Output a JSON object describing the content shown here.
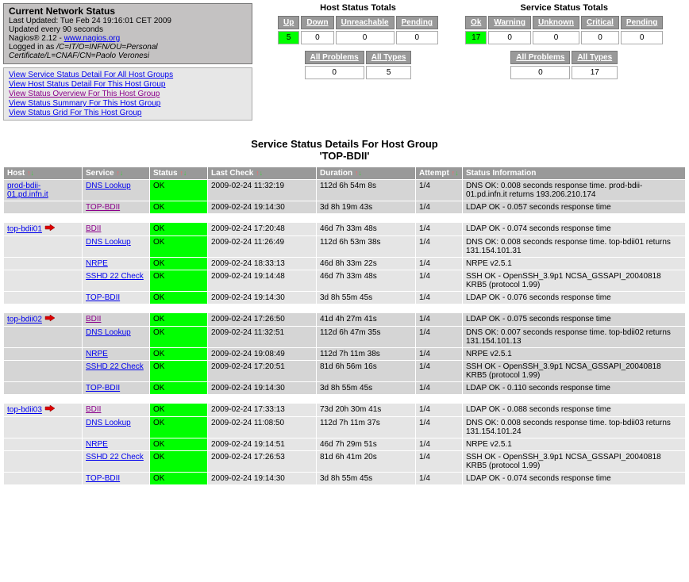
{
  "info": {
    "title": "Current Network Status",
    "last_updated": "Last Updated: Tue Feb 24 19:16:01 CET 2009",
    "updated_every": "Updated every 90 seconds",
    "nagios_prefix": "Nagios® 2.12 - ",
    "nagios_link": "www.nagios.org",
    "logged_in_prefix": "Logged in as ",
    "logged_in_user": "/C=IT/O=INFN/OU=Personal Certificate/L=CNAF/CN=Paolo Veronesi"
  },
  "links": [
    {
      "text": "View Service Status Detail For All Host Groups",
      "visited": false
    },
    {
      "text": "View Host Status Detail For This Host Group",
      "visited": false
    },
    {
      "text": "View Status Overview For This Host Group",
      "visited": true
    },
    {
      "text": "View Status Summary For This Host Group",
      "visited": false
    },
    {
      "text": "View Status Grid For This Host Group",
      "visited": false
    }
  ],
  "host_totals": {
    "title": "Host Status Totals",
    "headers": [
      "Up",
      "Down",
      "Unreachable",
      "Pending"
    ],
    "values": [
      "5",
      "0",
      "0",
      "0"
    ],
    "ok_index": 0,
    "summary_headers": [
      "All Problems",
      "All Types"
    ],
    "summary_values": [
      "0",
      "5"
    ]
  },
  "service_totals": {
    "title": "Service Status Totals",
    "headers": [
      "Ok",
      "Warning",
      "Unknown",
      "Critical",
      "Pending"
    ],
    "values": [
      "17",
      "0",
      "0",
      "0",
      "0"
    ],
    "ok_index": 0,
    "summary_headers": [
      "All Problems",
      "All Types"
    ],
    "summary_values": [
      "0",
      "17"
    ]
  },
  "page_title_1": "Service Status Details For Host Group",
  "page_title_2": "'TOP-BDII'",
  "columns": [
    "Host",
    "Service",
    "Status",
    "Last Check",
    "Duration",
    "Attempt",
    "Status Information"
  ],
  "groups": [
    {
      "host": "prod-bdii-01.pd.infn.it",
      "passive": false,
      "style": "odd",
      "rows": [
        {
          "service": "DNS Lookup",
          "status": "OK",
          "last": "2009-02-24 11:32:19",
          "dur": "112d 6h 54m 8s",
          "att": "1/4",
          "info": "DNS OK: 0.008 seconds response time. prod-bdii-01.pd.infn.it returns 193.206.210.174"
        },
        {
          "service": "TOP-BDII",
          "status": "OK",
          "last": "2009-02-24 19:14:30",
          "dur": "3d 8h 19m 43s",
          "att": "1/4",
          "info": "LDAP OK - 0.057 seconds response time",
          "visited": true
        }
      ]
    },
    {
      "host": "top-bdii01",
      "passive": true,
      "style": "even",
      "rows": [
        {
          "service": "BDII",
          "status": "OK",
          "last": "2009-02-24 17:20:48",
          "dur": "46d 7h 33m 48s",
          "att": "1/4",
          "info": "LDAP OK - 0.074 seconds response time",
          "visited": true
        },
        {
          "service": "DNS Lookup",
          "status": "OK",
          "last": "2009-02-24 11:26:49",
          "dur": "112d 6h 53m 38s",
          "att": "1/4",
          "info": "DNS OK: 0.008 seconds response time. top-bdii01 returns 131.154.101.31"
        },
        {
          "service": "NRPE",
          "status": "OK",
          "last": "2009-02-24 18:33:13",
          "dur": "46d 8h 33m 22s",
          "att": "1/4",
          "info": "NRPE v2.5.1"
        },
        {
          "service": "SSHD 22 Check",
          "status": "OK",
          "last": "2009-02-24 19:14:48",
          "dur": "46d 7h 33m 48s",
          "att": "1/4",
          "info": "SSH OK - OpenSSH_3.9p1 NCSA_GSSAPI_20040818 KRB5 (protocol 1.99)"
        },
        {
          "service": "TOP-BDII",
          "status": "OK",
          "last": "2009-02-24 19:14:30",
          "dur": "3d 8h 55m 45s",
          "att": "1/4",
          "info": "LDAP OK - 0.076 seconds response time"
        }
      ]
    },
    {
      "host": "top-bdii02",
      "passive": true,
      "style": "odd",
      "rows": [
        {
          "service": "BDII",
          "status": "OK",
          "last": "2009-02-24 17:26:50",
          "dur": "41d 4h 27m 41s",
          "att": "1/4",
          "info": "LDAP OK - 0.075 seconds response time",
          "visited": true
        },
        {
          "service": "DNS Lookup",
          "status": "OK",
          "last": "2009-02-24 11:32:51",
          "dur": "112d 6h 47m 35s",
          "att": "1/4",
          "info": "DNS OK: 0.007 seconds response time. top-bdii02 returns 131.154.101.13"
        },
        {
          "service": "NRPE",
          "status": "OK",
          "last": "2009-02-24 19:08:49",
          "dur": "112d 7h 11m 38s",
          "att": "1/4",
          "info": "NRPE v2.5.1"
        },
        {
          "service": "SSHD 22 Check",
          "status": "OK",
          "last": "2009-02-24 17:20:51",
          "dur": "81d 6h 56m 16s",
          "att": "1/4",
          "info": "SSH OK - OpenSSH_3.9p1 NCSA_GSSAPI_20040818 KRB5 (protocol 1.99)"
        },
        {
          "service": "TOP-BDII",
          "status": "OK",
          "last": "2009-02-24 19:14:30",
          "dur": "3d 8h 55m 45s",
          "att": "1/4",
          "info": "LDAP OK - 0.110 seconds response time"
        }
      ]
    },
    {
      "host": "top-bdii03",
      "passive": true,
      "style": "even",
      "rows": [
        {
          "service": "BDII",
          "status": "OK",
          "last": "2009-02-24 17:33:13",
          "dur": "73d 20h 30m 41s",
          "att": "1/4",
          "info": "LDAP OK - 0.088 seconds response time",
          "visited": true
        },
        {
          "service": "DNS Lookup",
          "status": "OK",
          "last": "2009-02-24 11:08:50",
          "dur": "112d 7h 11m 37s",
          "att": "1/4",
          "info": "DNS OK: 0.008 seconds response time. top-bdii03 returns 131.154.101.24"
        },
        {
          "service": "NRPE",
          "status": "OK",
          "last": "2009-02-24 19:14:51",
          "dur": "46d 7h 29m 51s",
          "att": "1/4",
          "info": "NRPE v2.5.1"
        },
        {
          "service": "SSHD 22 Check",
          "status": "OK",
          "last": "2009-02-24 17:26:53",
          "dur": "81d 6h 41m 20s",
          "att": "1/4",
          "info": "SSH OK - OpenSSH_3.9p1 NCSA_GSSAPI_20040818 KRB5 (protocol 1.99)"
        },
        {
          "service": "TOP-BDII",
          "status": "OK",
          "last": "2009-02-24 19:14:30",
          "dur": "3d 8h 55m 45s",
          "att": "1/4",
          "info": "LDAP OK - 0.074 seconds response time"
        }
      ]
    }
  ]
}
